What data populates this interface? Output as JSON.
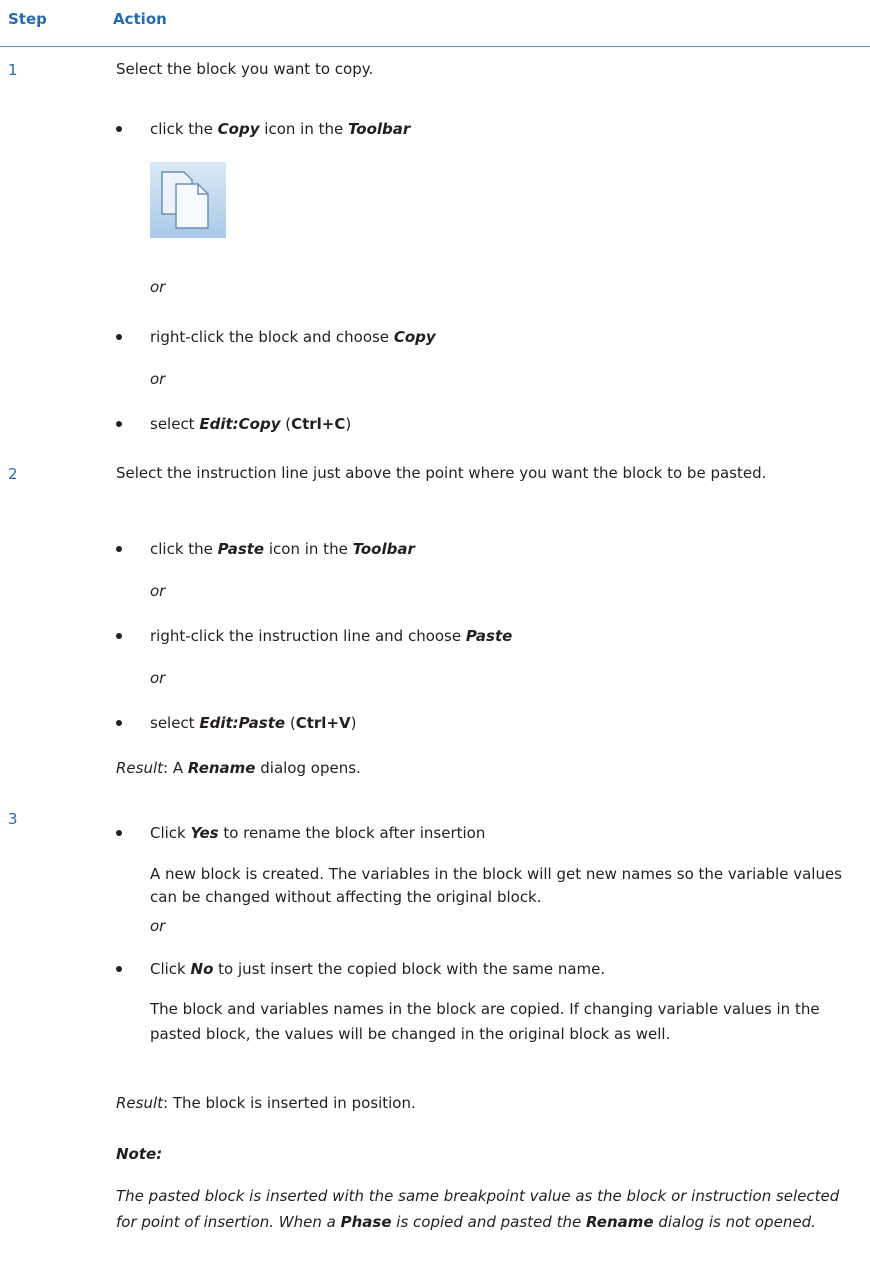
{
  "header": {
    "step": "Step",
    "action": "Action"
  },
  "steps": [
    {
      "number": "1"
    },
    {
      "number": "2"
    },
    {
      "number": "3"
    }
  ],
  "step1": {
    "intro": "Select the block you want to copy.",
    "b1_pre": "click the ",
    "b1_copy": "Copy",
    "b1_mid": " icon in the ",
    "b1_toolbar": "Toolbar",
    "or": "or",
    "b2_pre": "right-click the block and choose ",
    "b2_copy": "Copy",
    "b3_pre": "select ",
    "b3_menu": "Edit:Copy",
    "b3_open": " (",
    "b3_key": "Ctrl+C",
    "b3_close": ")",
    "icon": "copy-icon"
  },
  "step2": {
    "intro": "Select the instruction line just above the point where you want the block to be pasted.",
    "b1_pre": "click the ",
    "b1_paste": "Paste",
    "b1_mid": " icon in the ",
    "b1_toolbar": "Toolbar",
    "or": "or",
    "b2_pre": "right-click the instruction line and choose ",
    "b2_paste": "Paste",
    "b3_pre": "select ",
    "b3_menu": "Edit:Paste",
    "b3_open": " (",
    "b3_key": "Ctrl+V",
    "b3_close": ")",
    "result_label": "Result",
    "result_pre": ": A ",
    "result_rename": "Rename",
    "result_post": " dialog opens."
  },
  "step3": {
    "b1_pre": "Click ",
    "b1_yes": "Yes",
    "b1_post": " to rename the block after insertion",
    "b1_desc": "A new block is created. The variables in the block will get new names so the variable values can be changed without affecting the original block.",
    "or": "or",
    "b2_pre": "Click ",
    "b2_no": "No",
    "b2_post": " to just insert the copied block with the same name.",
    "b2_desc": "The block and variables names in the block are copied. If changing variable values in the pasted block, the values will be changed in the original block as well.",
    "result_label": "Result",
    "result_post": ": The block is inserted in position."
  },
  "note": {
    "label": "Note:",
    "t1": "The pasted block is inserted with the same breakpoint value as the block or instruction selected for point of insertion. When a ",
    "phase": "Phase",
    "t2": " is copied and pasted the ",
    "rename": "Rename",
    "t3": " dialog is not opened."
  }
}
